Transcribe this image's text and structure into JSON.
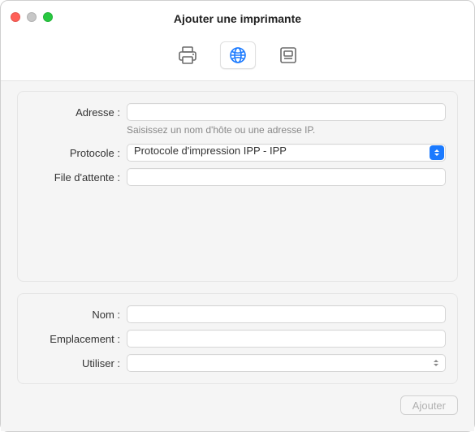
{
  "window": {
    "title": "Ajouter une imprimante"
  },
  "tabs": {
    "default_aria": "Imprimante par défaut",
    "ip_aria": "Imprimante IP",
    "windows_aria": "Imprimante Windows"
  },
  "form": {
    "address_label": "Adresse :",
    "address_value": "",
    "address_hint": "Saisissez un nom d'hôte ou une adresse IP.",
    "protocol_label": "Protocole :",
    "protocol_value": "Protocole d'impression IPP - IPP",
    "queue_label": "File d'attente :",
    "queue_value": "",
    "name_label": "Nom :",
    "name_value": "",
    "location_label": "Emplacement :",
    "location_value": "",
    "use_label": "Utiliser :",
    "use_value": ""
  },
  "footer": {
    "add_label": "Ajouter"
  }
}
